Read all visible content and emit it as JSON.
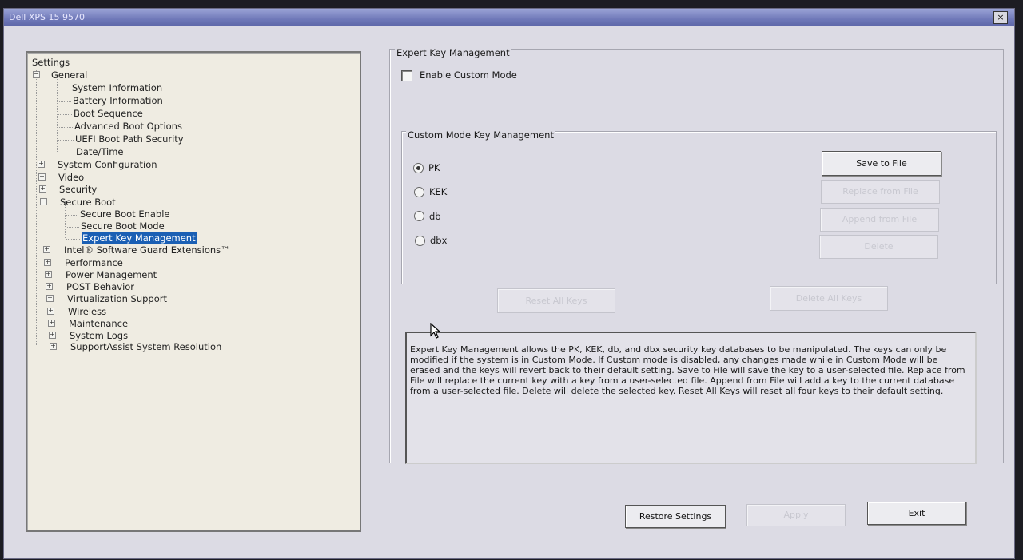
{
  "window": {
    "title": "Dell XPS 15 9570",
    "close_label": "×"
  },
  "tree": {
    "root": "Settings",
    "items": [
      {
        "label": "General"
      },
      {
        "label": "System Information"
      },
      {
        "label": "Battery Information"
      },
      {
        "label": "Boot Sequence"
      },
      {
        "label": "Advanced Boot Options"
      },
      {
        "label": "UEFI Boot Path Security"
      },
      {
        "label": "Date/Time"
      },
      {
        "label": "System Configuration"
      },
      {
        "label": "Video"
      },
      {
        "label": "Security"
      },
      {
        "label": "Secure Boot"
      },
      {
        "label": "Secure Boot Enable"
      },
      {
        "label": "Secure Boot Mode"
      },
      {
        "label": "Expert Key Management"
      },
      {
        "label": "Intel® Software Guard Extensions™"
      },
      {
        "label": "Performance"
      },
      {
        "label": "Power Management"
      },
      {
        "label": "POST Behavior"
      },
      {
        "label": "Virtualization Support"
      },
      {
        "label": "Wireless"
      },
      {
        "label": "Maintenance"
      },
      {
        "label": "System Logs"
      },
      {
        "label": "SupportAssist System Resolution"
      }
    ],
    "expander_plus": "+",
    "expander_minus": "−"
  },
  "panel": {
    "group_title": "Expert Key Management",
    "enable_custom_mode": {
      "label": "Enable Custom Mode",
      "checked": false
    },
    "custom_group_title": "Custom Mode Key Management",
    "radios": [
      {
        "label": "PK",
        "selected": true
      },
      {
        "label": "KEK",
        "selected": false
      },
      {
        "label": "db",
        "selected": false
      },
      {
        "label": "dbx",
        "selected": false
      }
    ],
    "buttons": {
      "save_to_file": "Save to File",
      "replace_from_file": "Replace from File",
      "append_from_file": "Append from File",
      "delete": "Delete",
      "reset_all_keys": "Reset All Keys",
      "delete_all_keys": "Delete All Keys"
    },
    "description": "Expert Key Management allows the PK, KEK, db, and dbx security key databases to be manipulated. The keys can only be modified if the system is in Custom Mode. If Custom mode is disabled, any changes made while in Custom Mode will be erased and the keys will revert back to their default setting. Save to File will save the key to a user-selected file. Replace from File will replace the current key with a key from a user-selected file. Append from File will add a key to the current database from a user-selected file. Delete will delete the selected key. Reset All Keys will reset all four keys to their default setting."
  },
  "footer": {
    "restore_settings": "Restore Settings",
    "apply": "Apply",
    "exit": "Exit"
  },
  "colors": {
    "titlebar": "#6f78b8",
    "selection": "#1a5fb4",
    "window_bg": "#dcdbe4",
    "tree_bg": "#efece2"
  }
}
